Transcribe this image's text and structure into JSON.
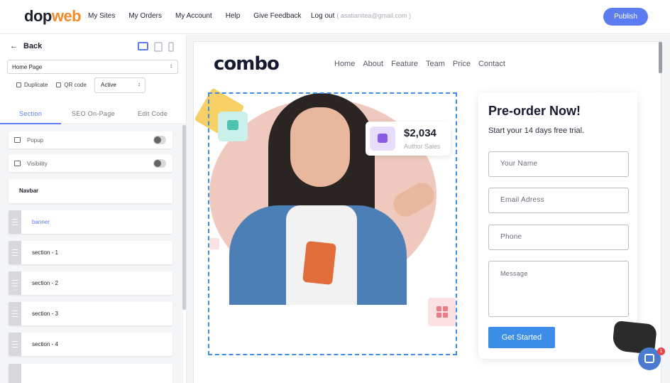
{
  "topbar": {
    "logo_main": "dop",
    "logo_accent": "web",
    "nav": [
      "My Sites",
      "My Orders",
      "My Account",
      "Help",
      "Give Feedback"
    ],
    "logout_label": "Log out",
    "email": "( asatianitea@gmail.com )",
    "publish_label": "Publish"
  },
  "panel": {
    "back_label": "Back",
    "page_select": "Home Page",
    "duplicate_label": "Duplicate",
    "qr_label": "QR code",
    "status_value": "Active",
    "tabs": [
      "Section",
      "SEO On-Page",
      "Edit Code"
    ],
    "active_tab": "Section",
    "toggles": [
      {
        "label": "Popup",
        "on": false
      },
      {
        "label": "Visibility",
        "on": false
      }
    ],
    "navbar_label": "Navbar",
    "sections": [
      "banner",
      "section - 1",
      "section - 2",
      "section - 3",
      "section - 4"
    ],
    "active_section": "banner"
  },
  "site": {
    "logo": "combo",
    "nav": [
      "Home",
      "About",
      "Feature",
      "Team",
      "Price",
      "Contact"
    ],
    "stat_value": "$2,034",
    "stat_label": "Author Sales",
    "form": {
      "title": "Pre-order Now!",
      "subtitle": "Start your 14 days free trial.",
      "fields": [
        "Your Name",
        "Email Adress",
        "Phone"
      ],
      "message_placeholder": "Message",
      "button": "Get Started"
    }
  },
  "chat": {
    "badge": "1"
  },
  "colors": {
    "accent": "#5b7cf0",
    "cta": "#3b8de8",
    "logo_orange": "#f08c2a"
  }
}
